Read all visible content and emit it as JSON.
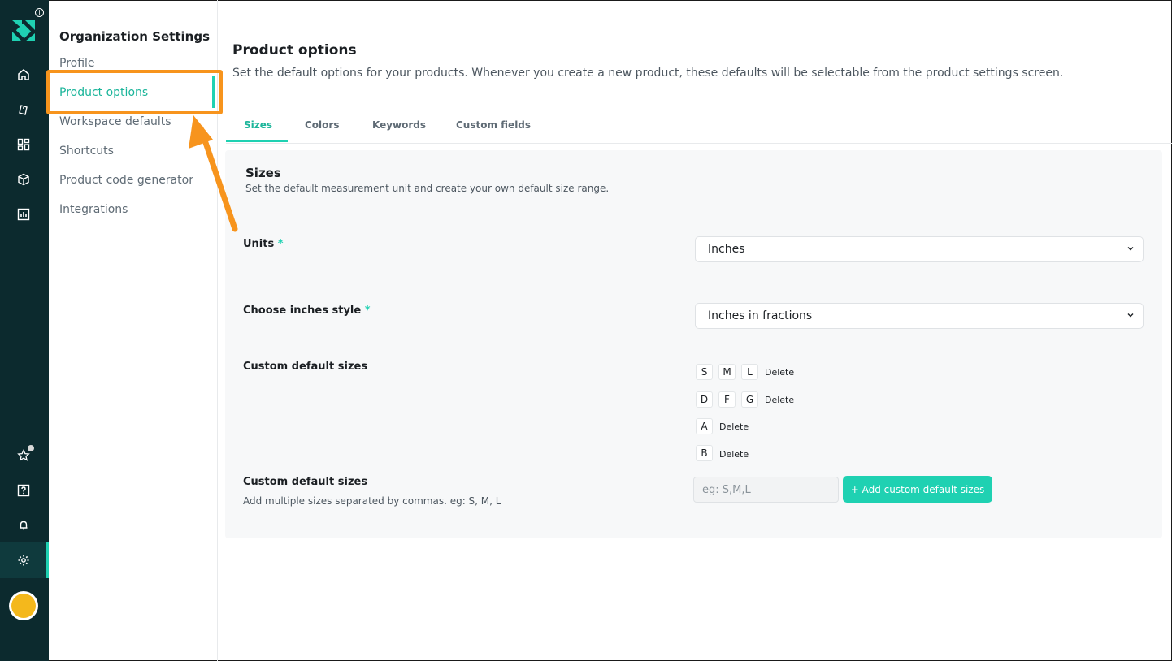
{
  "rail": {
    "info_glyph": "i",
    "icons": [
      "home-icon",
      "tag-icon",
      "grid-icon",
      "box-icon",
      "bar-chart-icon",
      "star-icon",
      "help-icon",
      "bell-icon",
      "gear-icon"
    ],
    "accent_color": "#1fd1b2",
    "background_color": "#0c2a2e"
  },
  "settings_nav": {
    "title": "Organization Settings",
    "items": [
      {
        "label": "Profile"
      },
      {
        "label": "Product options"
      },
      {
        "label": "Workspace defaults"
      },
      {
        "label": "Shortcuts"
      },
      {
        "label": "Product code generator"
      },
      {
        "label": "Integrations"
      }
    ],
    "active_index": 1
  },
  "page": {
    "title": "Product options",
    "description": "Set the default options for your products. Whenever you create a new product, these defaults will be selectable from the product settings screen."
  },
  "tabs": [
    {
      "label": "Sizes"
    },
    {
      "label": "Colors"
    },
    {
      "label": "Keywords"
    },
    {
      "label": "Custom fields"
    }
  ],
  "sizes_panel": {
    "title": "Sizes",
    "description": "Set the default measurement unit and create your own default size range.",
    "units": {
      "label": "Units",
      "required_mark": "*",
      "value": "Inches"
    },
    "inches_style": {
      "label": "Choose inches style",
      "required_mark": "*",
      "value": "Inches in fractions"
    },
    "custom_sizes": {
      "label": "Custom default sizes",
      "groups": [
        {
          "sizes": [
            "S",
            "M",
            "L"
          ],
          "delete_label": "Delete"
        },
        {
          "sizes": [
            "D",
            "F",
            "G"
          ],
          "delete_label": "Delete"
        },
        {
          "sizes": [
            "A"
          ],
          "delete_label": "Delete"
        },
        {
          "sizes": [
            "B"
          ],
          "delete_label": "Delete"
        }
      ]
    },
    "add_sizes": {
      "label": "Custom default sizes",
      "hint": "Add multiple sizes separated by commas. eg: S, M, L",
      "placeholder": "eg: S,M,L",
      "button_label": "+ Add custom default sizes"
    }
  },
  "colors": {
    "accent": "#1fd1b2",
    "highlight_annotation": "#f7941d"
  }
}
